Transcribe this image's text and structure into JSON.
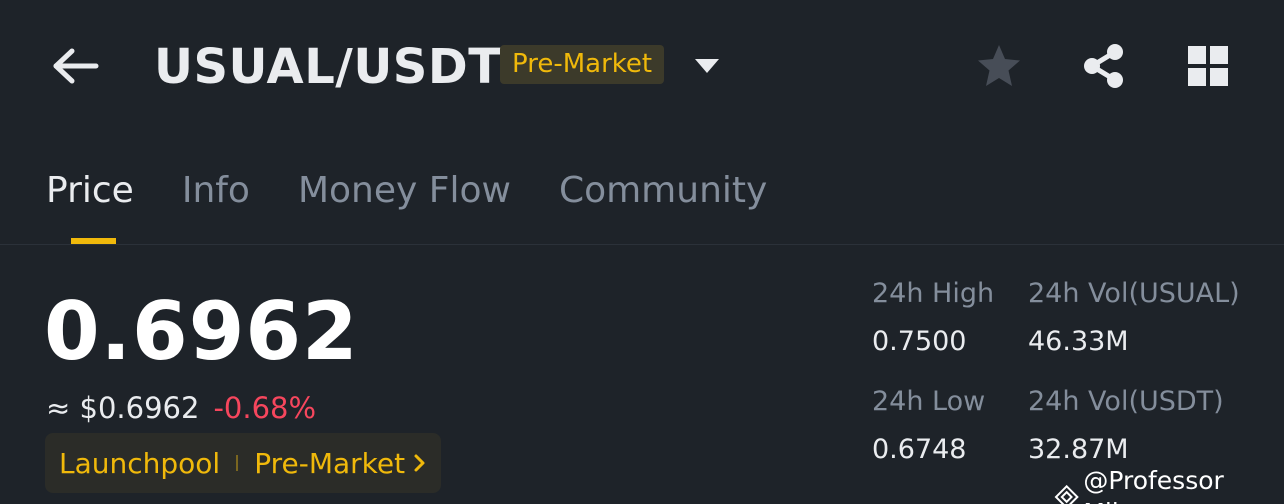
{
  "header": {
    "back_icon": "arrow-left-icon",
    "pair": "USUAL/USDT",
    "badge": "Pre-Market",
    "caret_icon": "caret-down-icon",
    "favorite_icon": "star-icon",
    "share_icon": "share-icon",
    "layout_icon": "grid-icon"
  },
  "tabs": [
    {
      "label": "Price",
      "active": true
    },
    {
      "label": "Info",
      "active": false
    },
    {
      "label": "Money Flow",
      "active": false
    },
    {
      "label": "Community",
      "active": false
    }
  ],
  "price": {
    "last": "0.6962",
    "fiat": "≈ $0.6962",
    "change": "-0.68%",
    "change_color": "#f6465d"
  },
  "tags": {
    "first": "Launchpool",
    "second": "Pre-Market"
  },
  "stats": {
    "high_label": "24h High",
    "high_value": "0.7500",
    "vol_base_label": "24h Vol(USUAL)",
    "vol_base_value": "46.33M",
    "low_label": "24h Low",
    "low_value": "0.6748",
    "vol_quote_label": "24h Vol(USDT)",
    "vol_quote_value": "32.87M"
  },
  "watermark": "@Professor Mike",
  "colors": {
    "background": "#1e2329",
    "accent": "#f0b90b",
    "text_primary": "#eaecef",
    "text_secondary": "#848e9c",
    "negative": "#f6465d"
  }
}
